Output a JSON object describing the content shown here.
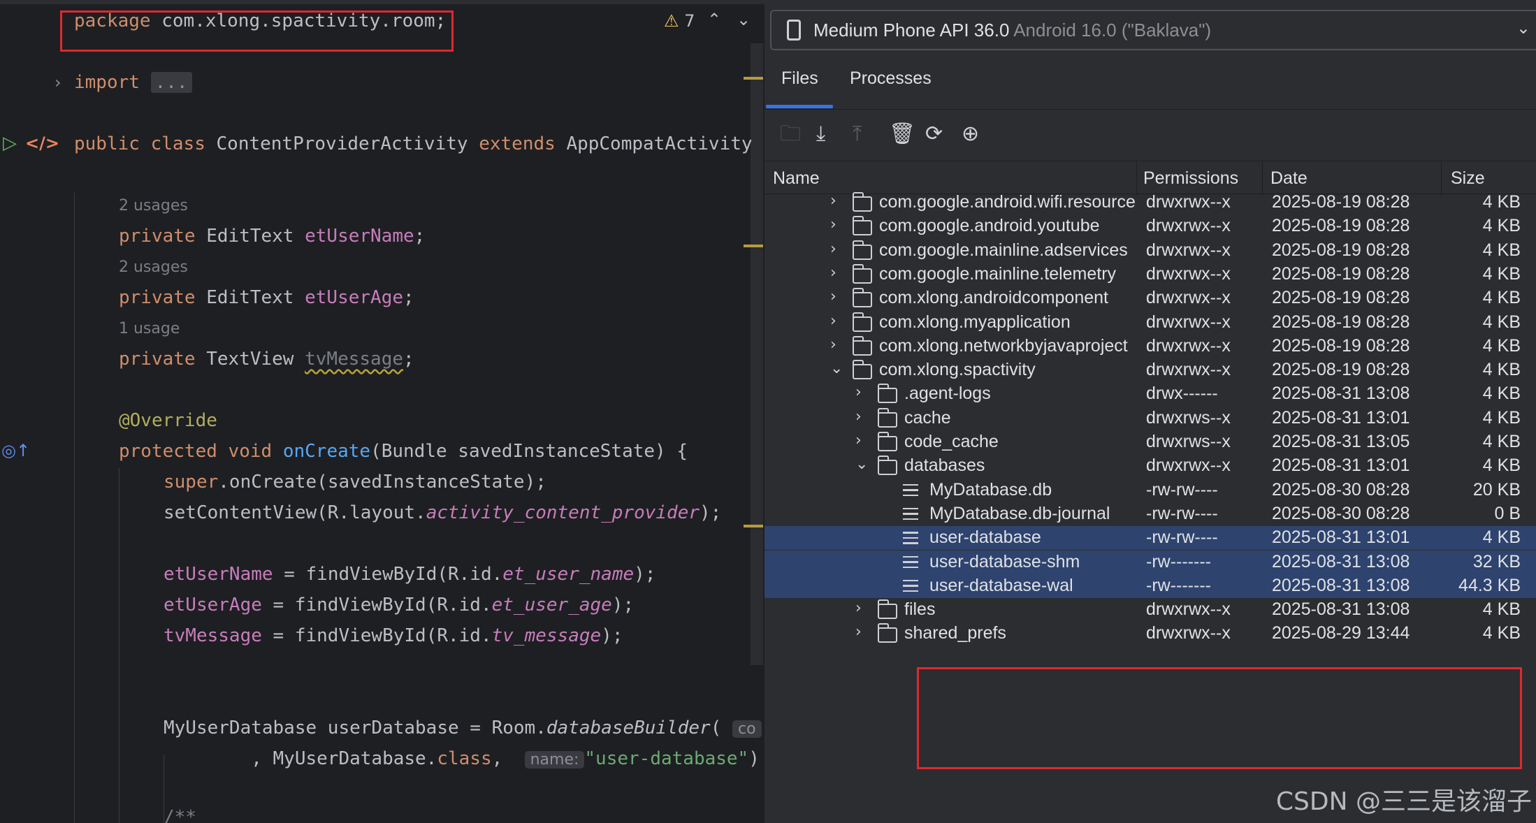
{
  "editor": {
    "warning_count": "7",
    "lines": {
      "package_kw": "package",
      "package_name": " com.xlong.spactivity.room;",
      "import_kw": "import",
      "import_dots": "...",
      "class_public": "public",
      "class_kw": "class",
      "class_name": "ContentProviderActivity",
      "class_extends": "extends",
      "class_parent": "AppCompatActivity",
      "usages_1": "2 usages",
      "field1_private": "private",
      "field1_type": "EditText",
      "field1_name": "etUserName",
      "usages_2": "2 usages",
      "field2_private": "private",
      "field2_type": "EditText",
      "field2_name": "etUserAge",
      "usages_3": "1 usage",
      "field3_private": "private",
      "field3_type": "TextView",
      "field3_name": "tvMessage",
      "override": "@Override",
      "method_protected": "protected",
      "method_void": "void",
      "method_name": "onCreate",
      "method_params": "(Bundle savedInstanceState) {",
      "super_kw": "super",
      "super_call": ".onCreate(savedInstanceState);",
      "setcv_prefix": "setContentView(R.layout.",
      "setcv_layout": "activity_content_provider",
      "setcv_suffix": ");",
      "fvb1_field": "etUserName",
      "fvb1_prefix": " = findViewById(R.id.",
      "fvb1_id": "et_user_name",
      "fvb1_suffix": ");",
      "fvb2_field": "etUserAge",
      "fvb2_prefix": " = findViewById(R.id.",
      "fvb2_id": "et_user_age",
      "fvb2_suffix": ");",
      "fvb3_field": "tvMessage",
      "fvb3_prefix": " = findViewById(R.id.",
      "fvb3_id": "tv_message",
      "fvb3_suffix": ");",
      "db_prefix": "MyUserDatabase userDatabase = Room.",
      "db_builder": "databaseBuilder",
      "db_paren": "(",
      "db_hint": "co",
      "db2_prefix": "        , MyUserDatabase.",
      "db2_class": "class",
      "db2_comma": ", ",
      "db2_hint": "name:",
      "db2_string": "\"user-database\"",
      "db2_tail": ")",
      "comment_start": "/**"
    }
  },
  "explorer": {
    "device_name": "Medium Phone API 36.0",
    "device_sub": " Android 16.0 (\"Baklava\")",
    "tabs": [
      "Files",
      "Processes"
    ],
    "toolbar_icons": [
      "new-folder-icon",
      "download-icon",
      "upload-icon",
      "delete-icon",
      "sync-icon",
      "locate-icon"
    ],
    "columns": [
      "Name",
      "Permissions",
      "Date",
      "Size"
    ],
    "rows": [
      {
        "name": "com.google.android.wifi.resources",
        "perm": "drwxrwx--x",
        "date": "2025-08-19 08:28",
        "size": "4 KB",
        "kind": "folder",
        "level": 0,
        "expanded": false,
        "selected": false
      },
      {
        "name": "com.google.android.youtube",
        "perm": "drwxrwx--x",
        "date": "2025-08-19 08:28",
        "size": "4 KB",
        "kind": "folder",
        "level": 0,
        "expanded": false,
        "selected": false
      },
      {
        "name": "com.google.mainline.adservices",
        "perm": "drwxrwx--x",
        "date": "2025-08-19 08:28",
        "size": "4 KB",
        "kind": "folder",
        "level": 0,
        "expanded": false,
        "selected": false
      },
      {
        "name": "com.google.mainline.telemetry",
        "perm": "drwxrwx--x",
        "date": "2025-08-19 08:28",
        "size": "4 KB",
        "kind": "folder",
        "level": 0,
        "expanded": false,
        "selected": false
      },
      {
        "name": "com.xlong.androidcomponent",
        "perm": "drwxrwx--x",
        "date": "2025-08-19 08:28",
        "size": "4 KB",
        "kind": "folder",
        "level": 0,
        "expanded": false,
        "selected": false
      },
      {
        "name": "com.xlong.myapplication",
        "perm": "drwxrwx--x",
        "date": "2025-08-19 08:28",
        "size": "4 KB",
        "kind": "folder",
        "level": 0,
        "expanded": false,
        "selected": false
      },
      {
        "name": "com.xlong.networkbyjavaproject",
        "perm": "drwxrwx--x",
        "date": "2025-08-19 08:28",
        "size": "4 KB",
        "kind": "folder",
        "level": 0,
        "expanded": false,
        "selected": false
      },
      {
        "name": "com.xlong.spactivity",
        "perm": "drwxrwx--x",
        "date": "2025-08-19 08:28",
        "size": "4 KB",
        "kind": "folder",
        "level": 0,
        "expanded": true,
        "selected": false
      },
      {
        "name": ".agent-logs",
        "perm": "drwx------",
        "date": "2025-08-31 13:08",
        "size": "4 KB",
        "kind": "folder",
        "level": 1,
        "expanded": false,
        "selected": false
      },
      {
        "name": "cache",
        "perm": "drwxrws--x",
        "date": "2025-08-31 13:01",
        "size": "4 KB",
        "kind": "folder",
        "level": 1,
        "expanded": false,
        "selected": false
      },
      {
        "name": "code_cache",
        "perm": "drwxrws--x",
        "date": "2025-08-31 13:05",
        "size": "4 KB",
        "kind": "folder",
        "level": 1,
        "expanded": false,
        "selected": false
      },
      {
        "name": "databases",
        "perm": "drwxrwx--x",
        "date": "2025-08-31 13:01",
        "size": "4 KB",
        "kind": "folder",
        "level": 1,
        "expanded": true,
        "selected": false
      },
      {
        "name": "MyDatabase.db",
        "perm": "-rw-rw----",
        "date": "2025-08-30 08:28",
        "size": "20 KB",
        "kind": "file",
        "level": 2,
        "expanded": false,
        "selected": false
      },
      {
        "name": "MyDatabase.db-journal",
        "perm": "-rw-rw----",
        "date": "2025-08-30 08:28",
        "size": "0 B",
        "kind": "file",
        "level": 2,
        "expanded": false,
        "selected": false
      },
      {
        "name": "user-database",
        "perm": "-rw-rw----",
        "date": "2025-08-31 13:01",
        "size": "4 KB",
        "kind": "file",
        "level": 2,
        "expanded": false,
        "selected": true
      },
      {
        "name": "user-database-shm",
        "perm": "-rw-------",
        "date": "2025-08-31 13:08",
        "size": "32 KB",
        "kind": "file",
        "level": 2,
        "expanded": false,
        "selected": true
      },
      {
        "name": "user-database-wal",
        "perm": "-rw-------",
        "date": "2025-08-31 13:08",
        "size": "44.3 KB",
        "kind": "file",
        "level": 2,
        "expanded": false,
        "selected": true
      },
      {
        "name": "files",
        "perm": "drwxrwx--x",
        "date": "2025-08-31 13:08",
        "size": "4 KB",
        "kind": "folder",
        "level": 1,
        "expanded": false,
        "selected": false
      },
      {
        "name": "shared_prefs",
        "perm": "drwxrwx--x",
        "date": "2025-08-29 13:44",
        "size": "4 KB",
        "kind": "folder",
        "level": 1,
        "expanded": false,
        "selected": false
      }
    ]
  },
  "watermark": "CSDN @三三是该溜子"
}
